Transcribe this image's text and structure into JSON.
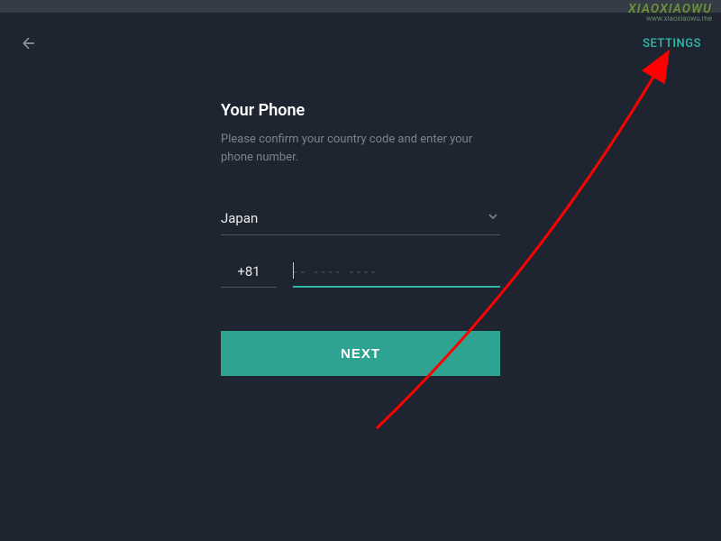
{
  "header": {
    "settings_label": "SETTINGS"
  },
  "form": {
    "title": "Your Phone",
    "subtitle": "Please confirm your country code and enter your phone number.",
    "country": "Japan",
    "country_code": "+81",
    "phone_value": "",
    "phone_placeholder": "-- ---- ----",
    "next_label": "NEXT"
  },
  "watermark": {
    "logo": "XIAOXIAOWU",
    "url": "www.xiaoxiaowu.me"
  },
  "colors": {
    "accent": "#2fb9a9",
    "background": "#1e2530"
  }
}
